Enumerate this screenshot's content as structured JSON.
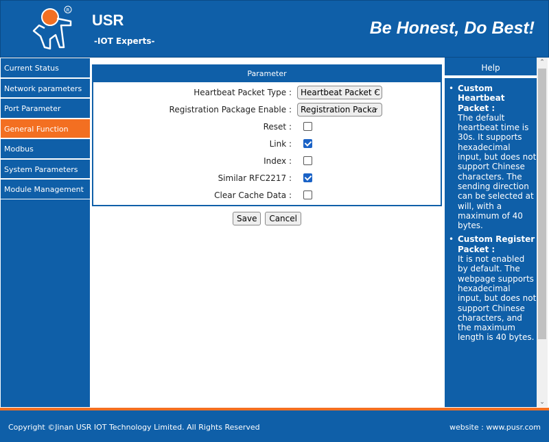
{
  "header": {
    "brand": "USR",
    "tagline": "-IOT Experts-",
    "slogan": "Be Honest, Do Best!",
    "logo_mark": "®"
  },
  "sidebar": {
    "items": [
      {
        "label": "Current Status"
      },
      {
        "label": "Network parameters"
      },
      {
        "label": "Port Parameter"
      },
      {
        "label": "General Function",
        "active": true
      },
      {
        "label": "Modbus"
      },
      {
        "label": "System Parameters"
      },
      {
        "label": "Module Management"
      }
    ]
  },
  "panel": {
    "title": "Parameter",
    "heartbeat_label": "Heartbeat Packet Type :",
    "heartbeat_value": "Heartbeat Packet C",
    "registration_label": "Registration Package Enable :",
    "registration_value": "Registration Packa",
    "reset_label": "Reset :",
    "reset_checked": false,
    "link_label": "Link :",
    "link_checked": true,
    "index_label": "Index :",
    "index_checked": false,
    "rfc_label": "Similar RFC2217 :",
    "rfc_checked": true,
    "clear_label": "Clear Cache Data :",
    "clear_checked": false
  },
  "buttons": {
    "save": "Save",
    "cancel": "Cancel"
  },
  "help": {
    "title": "Help",
    "items": [
      {
        "title": "Custom Heartbeat Packet :",
        "text": "The default heartbeat time is 30s. It supports hexadecimal input, but does not support Chinese characters. The sending direction can be selected at will, with a maximum of 40 bytes."
      },
      {
        "title": "Custom Register Packet :",
        "text": "It is not enabled by default. The webpage supports hexadecimal input, but does not support Chinese characters, and the maximum length is 40 bytes."
      }
    ]
  },
  "footer": {
    "copyright": "Copyright ©Jinan USR IOT Technology Limited. All Rights Reserved",
    "website_label": "website : ",
    "website_link": "www.pusr.com"
  },
  "colors": {
    "primary": "#0f5fa8",
    "accent": "#f36f21"
  }
}
